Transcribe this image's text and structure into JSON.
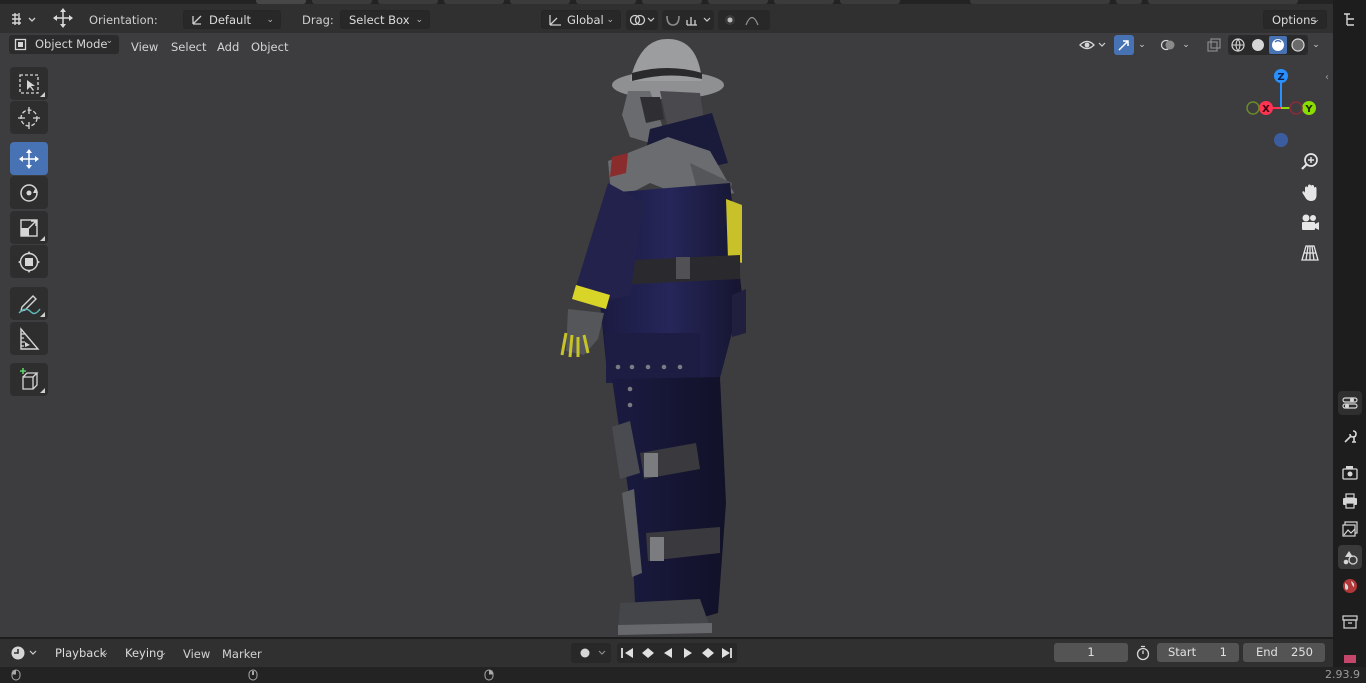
{
  "header": {
    "orientation_label": "Orientation:",
    "orientation_value": "Default",
    "drag_label": "Drag:",
    "drag_value": "Select Box",
    "transform_orientation": "Global",
    "options_label": "Options"
  },
  "viewport_header": {
    "mode": "Object Mode",
    "menus": [
      "View",
      "Select",
      "Add",
      "Object"
    ]
  },
  "toolbar": {
    "tools": [
      "select-box",
      "cursor",
      "move",
      "rotate",
      "scale",
      "transform",
      "annotate",
      "measure",
      "add-cube"
    ],
    "active": "move"
  },
  "gizmo": {
    "axis_x": "X",
    "axis_y": "Y",
    "axis_z": "Z",
    "colors": {
      "x": "#ff3352",
      "y": "#8bdc00",
      "z": "#2890ff",
      "neg": "#3b5da0"
    }
  },
  "timeline": {
    "playback": "Playback",
    "keying": "Keying",
    "view": "View",
    "marker": "Marker",
    "current_frame": "1",
    "start_label": "Start",
    "start_value": "1",
    "end_label": "End",
    "end_value": "250"
  },
  "status": {
    "version": "2.93.9"
  },
  "colors": {
    "accent": "#4772b3",
    "viewport_bg": "#3d3d40",
    "header_bg": "#303030"
  }
}
